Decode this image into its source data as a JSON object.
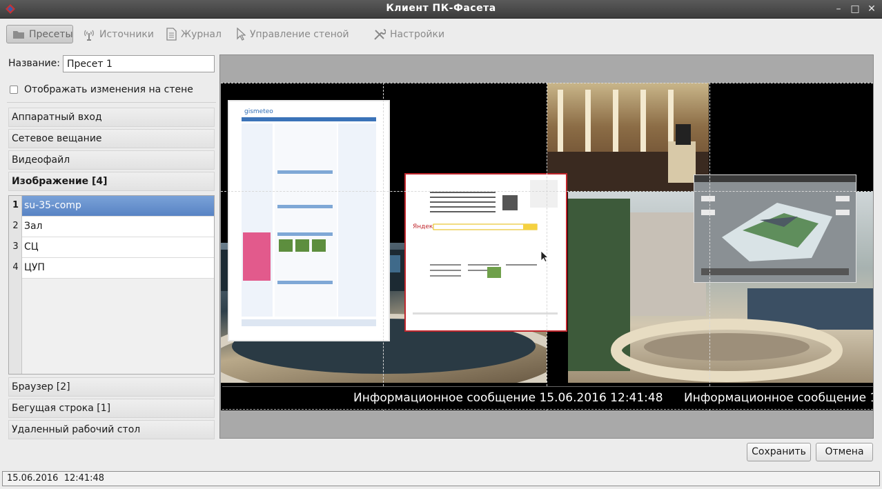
{
  "window": {
    "title": "Клиент ПК-Фасета"
  },
  "toolbar": {
    "presets": "Пресеты",
    "sources": "Источники",
    "journal": "Журнал",
    "wall": "Управление стеной",
    "settings": "Настройки"
  },
  "preset": {
    "name_label": "Название:",
    "name_value": "Пресет 1",
    "show_changes_label": "Отображать изменения на стене",
    "show_changes_checked": false
  },
  "categories": {
    "hw": "Аппаратный вход",
    "net": "Сетевое вещание",
    "video": "Видеофайл",
    "image": "Изображение [4]",
    "browser": "Браузер [2]",
    "ticker": "Бегущая строка [1]",
    "rdp": "Удаленный рабочий стол"
  },
  "image_list": [
    {
      "num": "1",
      "name": "su-35-comp",
      "selected": true
    },
    {
      "num": "2",
      "name": "Зал"
    },
    {
      "num": "3",
      "name": "СЦ"
    },
    {
      "num": "4",
      "name": "ЦУП"
    }
  ],
  "wall": {
    "ticker_text": "Информационное сообщение 15.06.2016 12:41:48",
    "window_icons": [
      "gismeteo-browser-window",
      "yandex-browser-window",
      "hall-photo",
      "control-room-photo",
      "mission-control-photo",
      "su-35-image"
    ]
  },
  "buttons": {
    "save": "Сохранить",
    "cancel": "Отмена"
  },
  "status": {
    "datetime": "15.06.2016  12:41:48"
  },
  "colors": {
    "selection": "#5883c4",
    "wall_bg": "#000000",
    "active_window_border": "#c0262c"
  }
}
